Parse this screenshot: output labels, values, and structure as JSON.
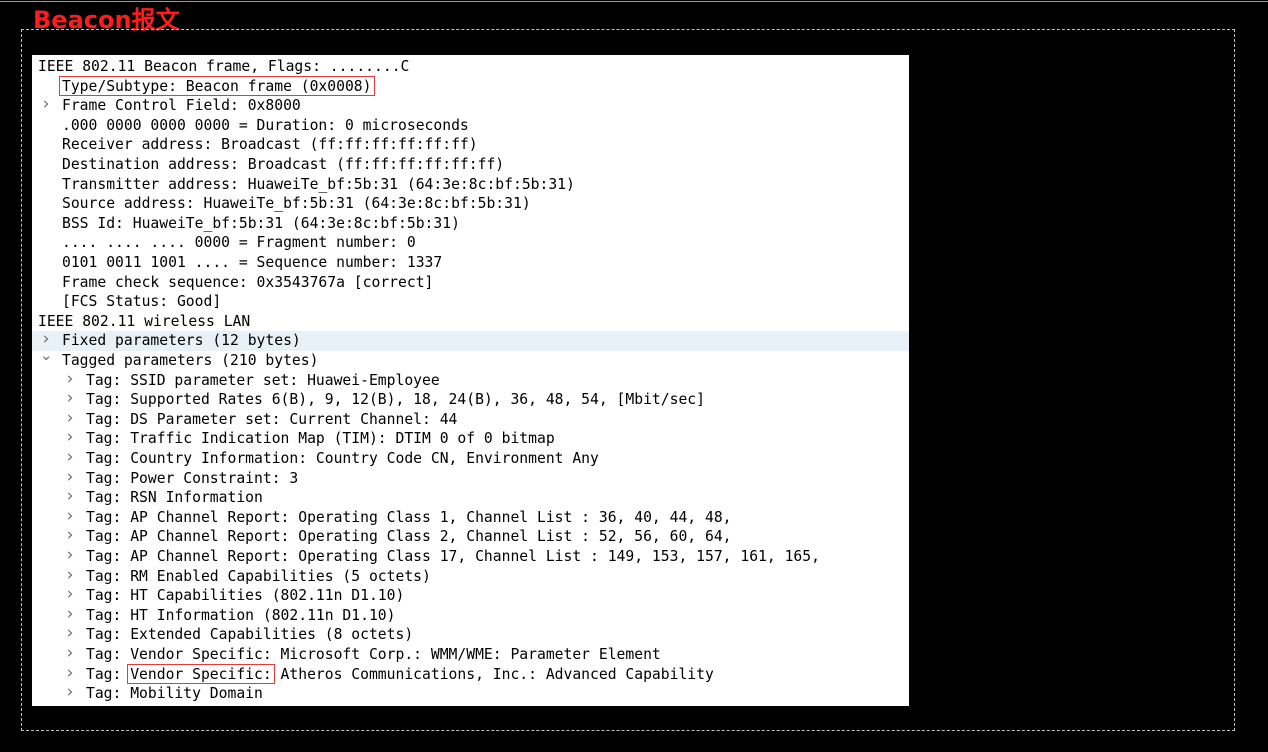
{
  "title": "Beacon报文",
  "colors": {
    "title": "#ff1c1c",
    "highlight_box": "#e43a3a",
    "selected_row": "#e8f0f8"
  },
  "tree": [
    {
      "indent": 0,
      "toggle": "",
      "text": "IEEE 802.11 Beacon frame, Flags: ........C"
    },
    {
      "indent": 1,
      "toggle": "",
      "text": "Type/Subtype: Beacon frame (0x0008)",
      "boxed": true
    },
    {
      "indent": 1,
      "toggle": "collapsed",
      "text": "Frame Control Field: 0x8000"
    },
    {
      "indent": 1,
      "toggle": "",
      "text": ".000 0000 0000 0000 = Duration: 0 microseconds"
    },
    {
      "indent": 1,
      "toggle": "",
      "text": "Receiver address: Broadcast (ff:ff:ff:ff:ff:ff)"
    },
    {
      "indent": 1,
      "toggle": "",
      "text": "Destination address: Broadcast (ff:ff:ff:ff:ff:ff)"
    },
    {
      "indent": 1,
      "toggle": "",
      "text": "Transmitter address: HuaweiTe_bf:5b:31 (64:3e:8c:bf:5b:31)"
    },
    {
      "indent": 1,
      "toggle": "",
      "text": "Source address: HuaweiTe_bf:5b:31 (64:3e:8c:bf:5b:31)"
    },
    {
      "indent": 1,
      "toggle": "",
      "text": "BSS Id: HuaweiTe_bf:5b:31 (64:3e:8c:bf:5b:31)"
    },
    {
      "indent": 1,
      "toggle": "",
      "text": ".... .... .... 0000 = Fragment number: 0"
    },
    {
      "indent": 1,
      "toggle": "",
      "text": "0101 0011 1001 .... = Sequence number: 1337"
    },
    {
      "indent": 1,
      "toggle": "",
      "text": "Frame check sequence: 0x3543767a [correct]"
    },
    {
      "indent": 1,
      "toggle": "",
      "text": "[FCS Status: Good]"
    },
    {
      "indent": 0,
      "toggle": "",
      "text": "IEEE 802.11 wireless LAN"
    },
    {
      "indent": 1,
      "toggle": "collapsed",
      "text": "Fixed parameters (12 bytes)",
      "selected": true
    },
    {
      "indent": 1,
      "toggle": "expanded",
      "text": "Tagged parameters (210 bytes)"
    },
    {
      "indent": 2,
      "toggle": "collapsed",
      "text": "Tag: SSID parameter set: Huawei-Employee"
    },
    {
      "indent": 2,
      "toggle": "collapsed",
      "text": "Tag: Supported Rates 6(B), 9, 12(B), 18, 24(B), 36, 48, 54, [Mbit/sec]"
    },
    {
      "indent": 2,
      "toggle": "collapsed",
      "text": "Tag: DS Parameter set: Current Channel: 44"
    },
    {
      "indent": 2,
      "toggle": "collapsed",
      "text": "Tag: Traffic Indication Map (TIM): DTIM 0 of 0 bitmap"
    },
    {
      "indent": 2,
      "toggle": "collapsed",
      "text": "Tag: Country Information: Country Code CN, Environment Any"
    },
    {
      "indent": 2,
      "toggle": "collapsed",
      "text": "Tag: Power Constraint: 3"
    },
    {
      "indent": 2,
      "toggle": "collapsed",
      "text": "Tag: RSN Information"
    },
    {
      "indent": 2,
      "toggle": "collapsed",
      "text": "Tag: AP Channel Report: Operating Class 1, Channel List : 36, 40, 44, 48,"
    },
    {
      "indent": 2,
      "toggle": "collapsed",
      "text": "Tag: AP Channel Report: Operating Class 2, Channel List : 52, 56, 60, 64,"
    },
    {
      "indent": 2,
      "toggle": "collapsed",
      "text": "Tag: AP Channel Report: Operating Class 17, Channel List : 149, 153, 157, 161, 165,"
    },
    {
      "indent": 2,
      "toggle": "collapsed",
      "text": "Tag: RM Enabled Capabilities (5 octets)"
    },
    {
      "indent": 2,
      "toggle": "collapsed",
      "text": "Tag: HT Capabilities (802.11n D1.10)"
    },
    {
      "indent": 2,
      "toggle": "collapsed",
      "text": "Tag: HT Information (802.11n D1.10)"
    },
    {
      "indent": 2,
      "toggle": "collapsed",
      "text": "Tag: Extended Capabilities (8 octets)"
    },
    {
      "indent": 2,
      "toggle": "collapsed",
      "text": "Tag: Vendor Specific: Microsoft Corp.: WMM/WME: Parameter Element"
    },
    {
      "indent": 2,
      "toggle": "collapsed",
      "text": "Tag: Vendor Specific: Atheros Communications, Inc.: Advanced Capability",
      "boxed_part": "Vendor Specific:"
    },
    {
      "indent": 2,
      "toggle": "collapsed",
      "text": "Tag: Mobility Domain"
    }
  ]
}
